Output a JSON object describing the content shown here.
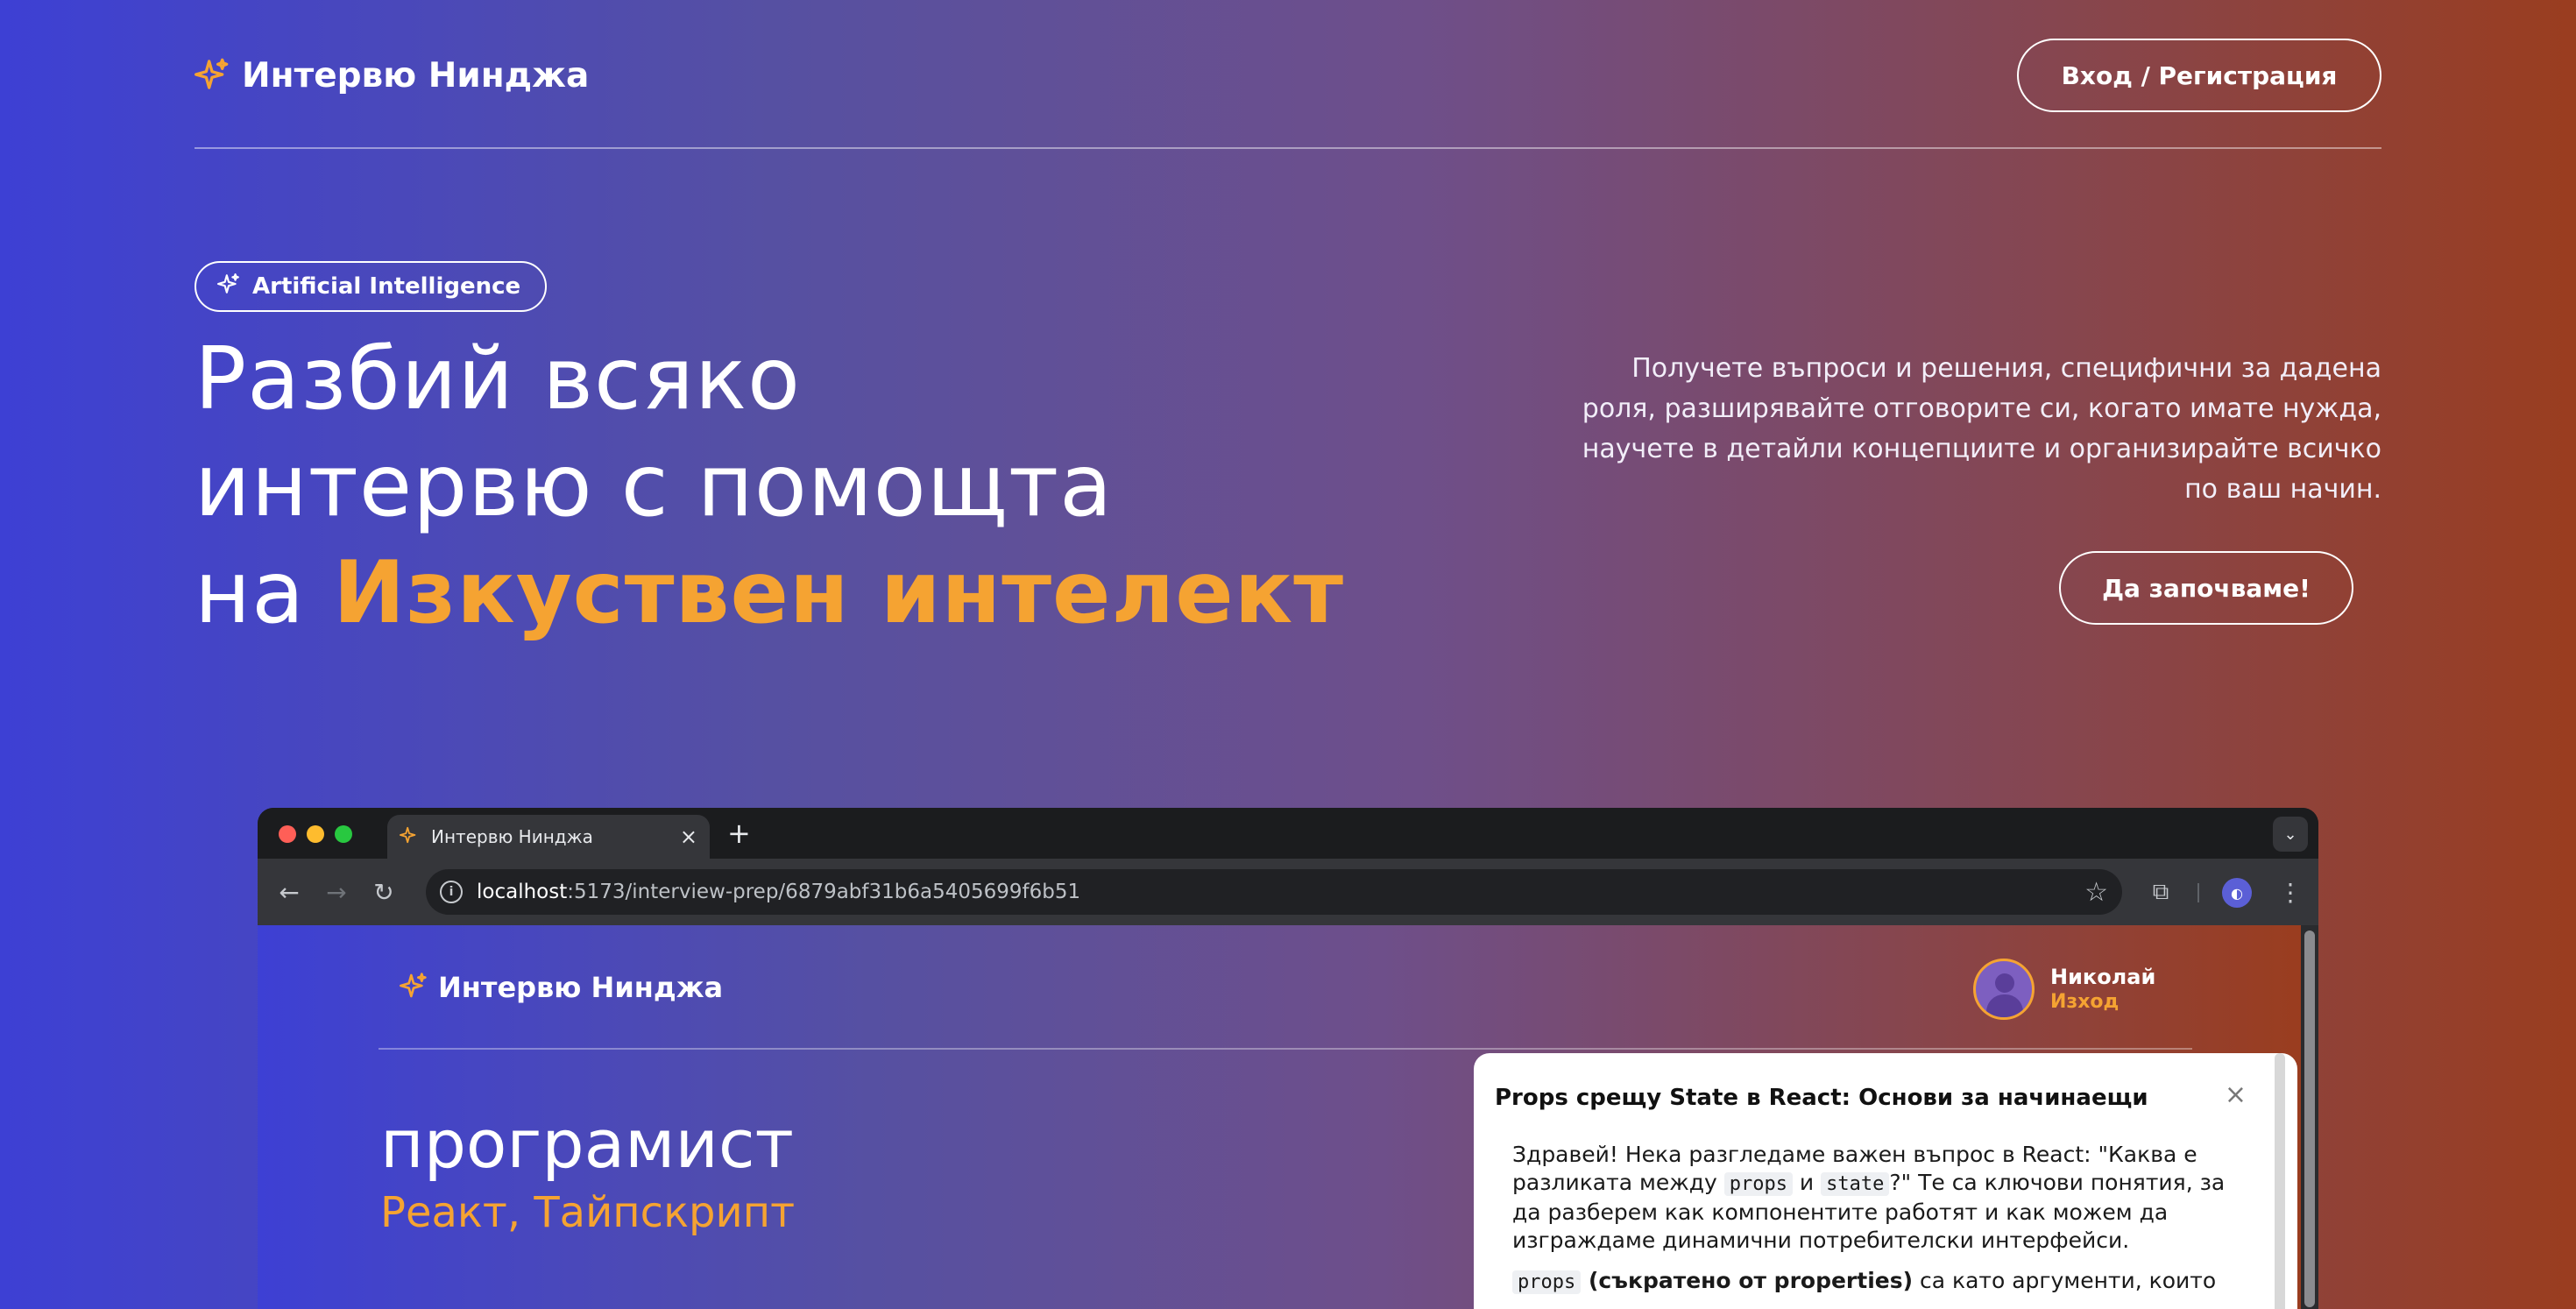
{
  "header": {
    "brand": "Интервю Нинджа",
    "login_button": "Вход / Регистрация"
  },
  "hero": {
    "badge": "Artificial Intelligence",
    "title_line1": "Разбий всяко",
    "title_line2": "интервю с помощта",
    "title_line3_prefix": "на ",
    "title_line3_accent": "Изкуствен интелект",
    "description": "Получете въпроси и решения, специфични за дадена роля, разширявайте отговорите си, когато имате нужда, научете в детайли концепциите и организирайте всичко по ваш начин.",
    "start_button": "Да започваме!"
  },
  "browser": {
    "tab_title": "Интервю Нинджа",
    "url_host": "localhost",
    "url_rest": ":5173/interview-prep/6879abf31b6a5405699f6b51",
    "inner": {
      "brand": "Интервю Нинджа",
      "user_name": "Николай",
      "logout": "Изход",
      "role_title": "програмист",
      "role_tech": "Реакт, Тайпскрипт"
    },
    "chat": {
      "title": "Props срещу State в React: Основи за начинаещи",
      "p1_a": "Здравей! Нека разгледаме важен въпрос в React: \"Каква е разликата между ",
      "p1_code1": "props",
      "p1_b": " и ",
      "p1_code2": "state",
      "p1_c": "?\" Те са ключови понятия, за да разберем как компонентите работят и как можем да изграждаме динамични потребителски интерфейси.",
      "p2_code": "props",
      "p2_bold": " (съкратено от properties)",
      "p2_rest": " са като аргументи, които"
    }
  },
  "colors": {
    "accent": "#f5a332",
    "gradient_start": "#3d40d4",
    "gradient_end": "#9a3d1f"
  }
}
